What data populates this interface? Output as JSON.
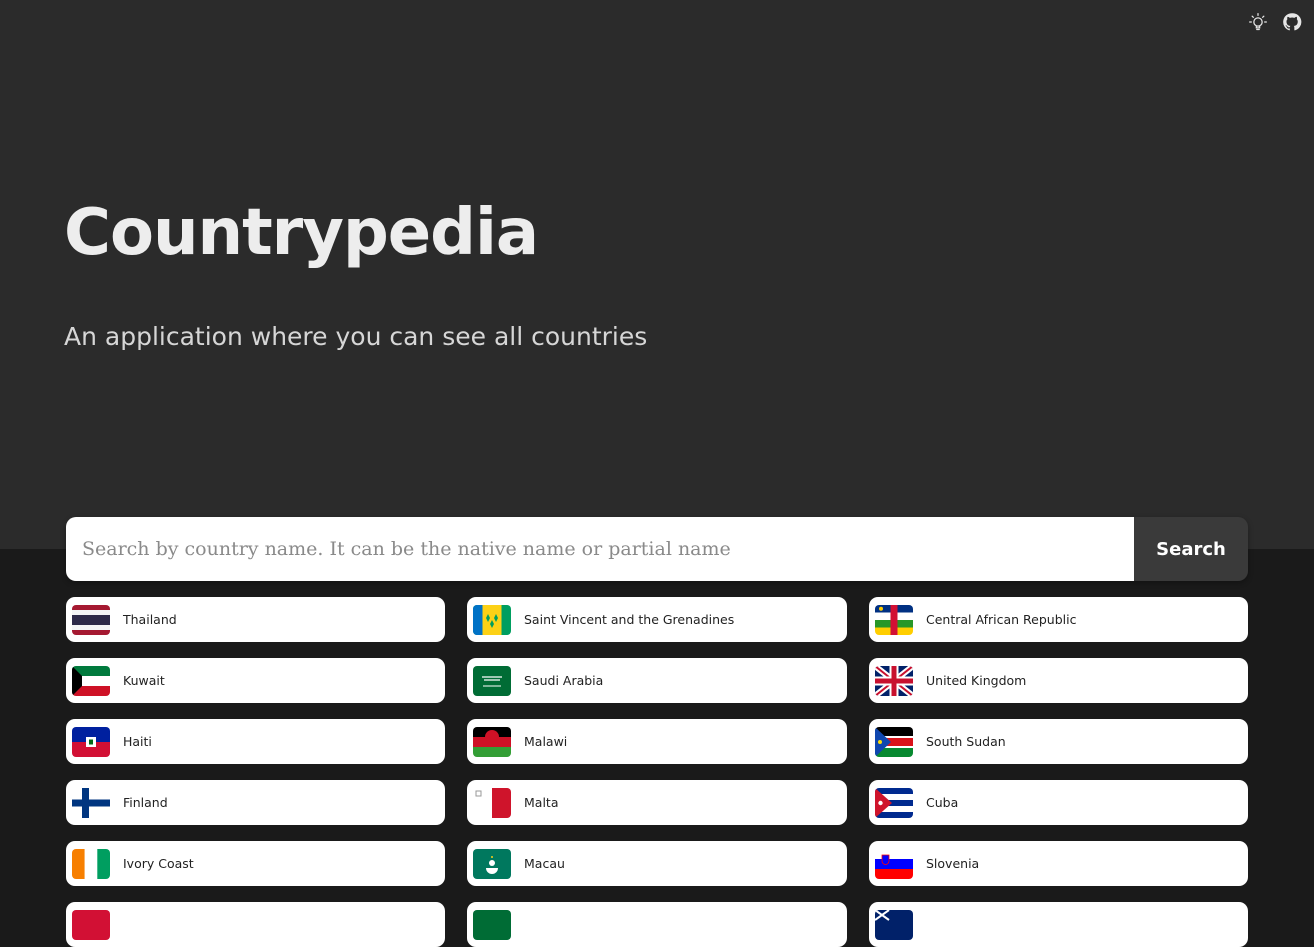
{
  "header": {
    "icons": [
      {
        "name": "lightbulb-icon",
        "label": "Toggle theme"
      },
      {
        "name": "github-icon",
        "label": "GitHub"
      }
    ]
  },
  "hero": {
    "title": "Countrypedia",
    "subtitle": "An application where you can see all countries"
  },
  "search": {
    "placeholder": "Search by country name. It can be the native name or partial name",
    "value": "",
    "button_label": "Search"
  },
  "countries": [
    {
      "name": "Thailand",
      "flag": "th"
    },
    {
      "name": "Saint Vincent and the Grenadines",
      "flag": "vc"
    },
    {
      "name": "Central African Republic",
      "flag": "cf"
    },
    {
      "name": "Kuwait",
      "flag": "kw"
    },
    {
      "name": "Saudi Arabia",
      "flag": "sa"
    },
    {
      "name": "United Kingdom",
      "flag": "gb"
    },
    {
      "name": "Haiti",
      "flag": "ht"
    },
    {
      "name": "Malawi",
      "flag": "mw"
    },
    {
      "name": "South Sudan",
      "flag": "ss"
    },
    {
      "name": "Finland",
      "flag": "fi"
    },
    {
      "name": "Malta",
      "flag": "mt"
    },
    {
      "name": "Cuba",
      "flag": "cu"
    },
    {
      "name": "Ivory Coast",
      "flag": "ci"
    },
    {
      "name": "Macau",
      "flag": "mo"
    },
    {
      "name": "Slovenia",
      "flag": "si"
    },
    {
      "name": "",
      "flag": "partial-red"
    },
    {
      "name": "",
      "flag": "partial-green"
    },
    {
      "name": "",
      "flag": "partial-blue"
    }
  ],
  "colors": {
    "hero_bg": "#2b2b2b",
    "page_bg": "#1a1a1a",
    "title": "#ededed",
    "card_bg": "#ffffff",
    "search_button_bg": "#3a3a3a"
  }
}
